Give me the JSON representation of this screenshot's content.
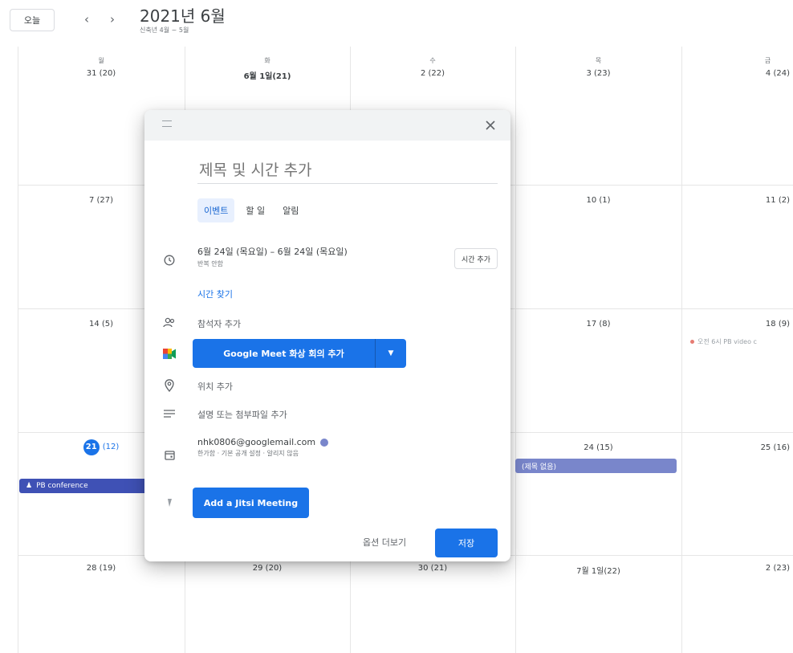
{
  "header": {
    "today_label": "오늘",
    "prev_icon": "‹",
    "next_icon": "›",
    "title": "2021년 6월",
    "subtitle": "신축년 4월 ~ 5월"
  },
  "weekdays": [
    "월",
    "화",
    "수",
    "목",
    "금"
  ],
  "weeks": [
    [
      "31 (20)",
      "6월 1일(21)",
      "2 (22)",
      "3 (23)",
      "4 (24)"
    ],
    [
      "7 (27)",
      "",
      "",
      "10 (1)",
      "11 (2)"
    ],
    [
      "14 (5)",
      "",
      "",
      "17 (8)",
      "18 (9)"
    ],
    [
      "(12)",
      "",
      "",
      "24 (15)",
      "25 (16)"
    ],
    [
      "28 (19)",
      "29 (20)",
      "30 (21)",
      "7월 1일(22)",
      "2 (23)"
    ]
  ],
  "today_date": "21",
  "events": {
    "pb_conference": "PB conference",
    "no_title": "(제목 없음)",
    "pb_video": "오전 6시 PB video c"
  },
  "colors": {
    "accent": "#1a73e8",
    "pb_conference_bg": "#3f51b5",
    "no_title_bg": "#7986cb",
    "event_dot": "#e67c73"
  },
  "dialog": {
    "title_placeholder": "제목 및 시간 추가",
    "tabs": [
      {
        "label": "이벤트",
        "active": true
      },
      {
        "label": "할 일",
        "active": false
      },
      {
        "label": "알림",
        "active": false
      }
    ],
    "date_range": "6월 24일 (목요일)  –  6월 24일 (목요일)",
    "repeat": "반복 안함",
    "add_time": "시간 추가",
    "find_time": "시간 찾기",
    "add_guests": "참석자 추가",
    "meet_button": "Google Meet 화상 회의 추가",
    "add_location": "위치 추가",
    "add_description": "설명 또는 첨부파일 추가",
    "calendar_email": "nhk0806@googlemail.com",
    "calendar_details": "한가함 · 기본 공개 설정 · 알리지 않음",
    "jitsi_button": "Add a Jitsi Meeting",
    "more_options": "옵션 더보기",
    "save": "저장"
  }
}
